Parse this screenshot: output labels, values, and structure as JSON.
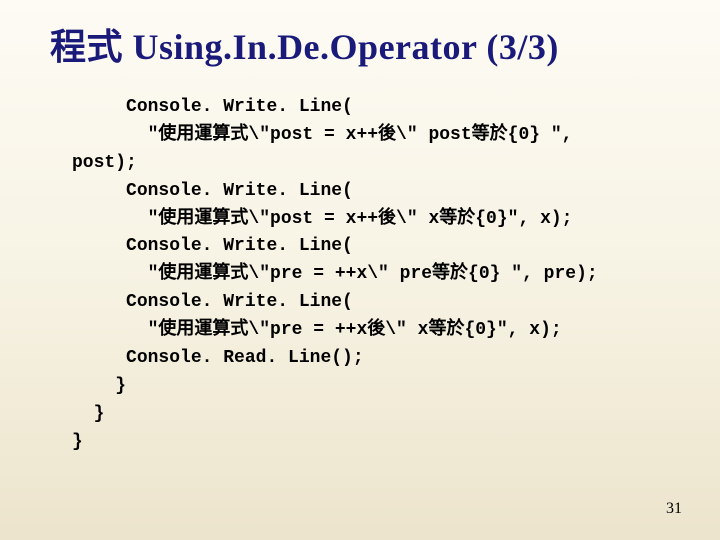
{
  "title": "程式 Using.In.De.Operator (3/3)",
  "code": {
    "l1": "     Console. Write. Line(",
    "l2": "       \"使用運算式\\\"post = x++後\\\" post等於{0} \",",
    "l3": "post);",
    "l4": "     Console. Write. Line(",
    "l5": "       \"使用運算式\\\"post = x++後\\\" x等於{0}\", x);",
    "l6": "     Console. Write. Line(",
    "l7": "       \"使用運算式\\\"pre = ++x\\\" pre等於{0} \", pre);",
    "l8": "     Console. Write. Line(",
    "l9": "       \"使用運算式\\\"pre = ++x後\\\" x等於{0}\", x);",
    "l10": "     Console. Read. Line();",
    "l11": "    }",
    "l12": "  }",
    "l13": "}"
  },
  "pagenum": "31"
}
